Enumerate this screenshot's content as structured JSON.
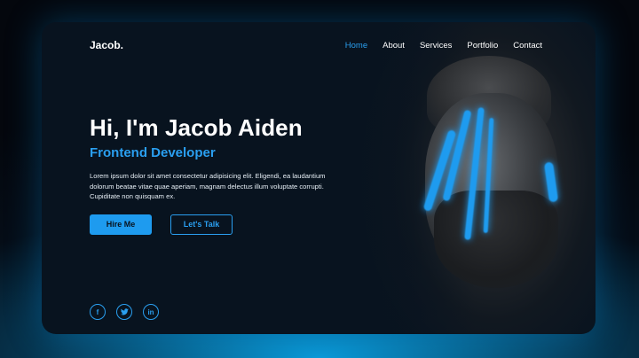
{
  "brand": {
    "logo": "Jacob."
  },
  "nav": {
    "items": [
      {
        "label": "Home",
        "active": true
      },
      {
        "label": "About"
      },
      {
        "label": "Services"
      },
      {
        "label": "Portfolio"
      },
      {
        "label": "Contact"
      }
    ]
  },
  "hero": {
    "title": "Hi, I'm Jacob Aiden",
    "subtitle": "Frontend Developer",
    "description": "Lorem ipsum dolor sit amet consectetur adipisicing elit. Eligendi, ea laudantium dolorum beatae vitae quae aperiam, magnam delectus illum voluptate corrupti. Cupiditate non quisquam ex.",
    "primary_button": "Hire Me",
    "secondary_button": "Let's Talk"
  },
  "socials": [
    {
      "icon": "facebook-icon",
      "glyph": "f"
    },
    {
      "icon": "twitter-icon",
      "glyph": "t"
    },
    {
      "icon": "linkedin-icon",
      "glyph": "in"
    }
  ],
  "colors": {
    "accent": "#1e9bef",
    "card_background": "#08131f",
    "glow": "#0a9ad8"
  }
}
